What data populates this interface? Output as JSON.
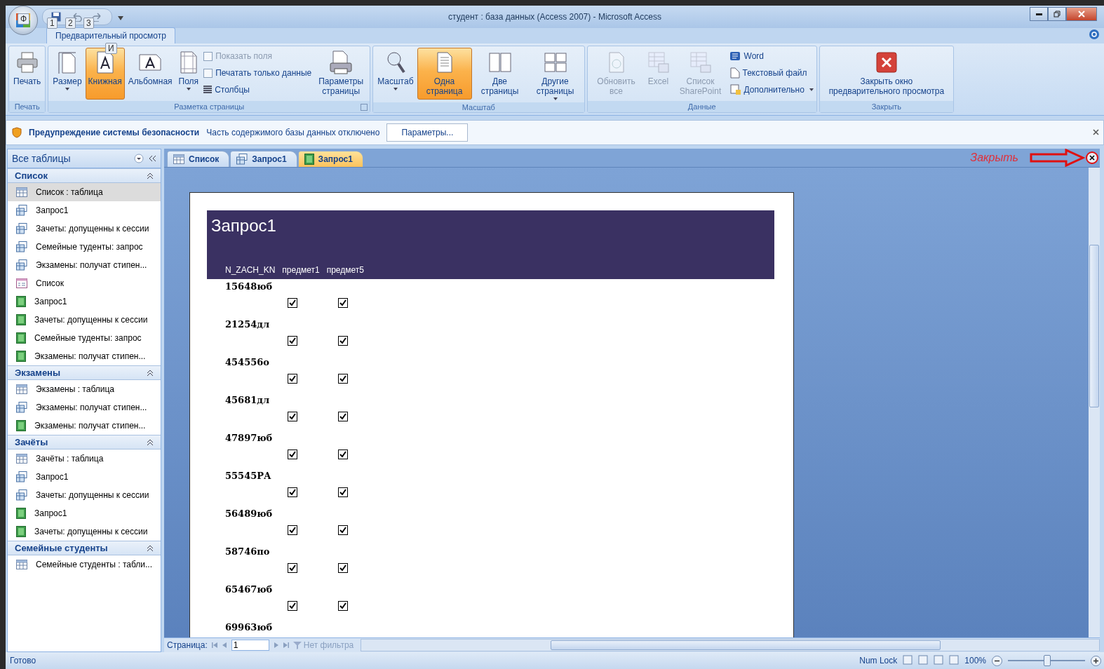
{
  "window": {
    "title": "студент : база данных (Access 2007) - Microsoft Access",
    "office_keytip": "Ф",
    "quick_keytips": [
      "1",
      "2",
      "3"
    ]
  },
  "ribbon": {
    "tab": {
      "label": "Предварительный просмотр",
      "keytip": "И",
      "selected": true
    },
    "groups": [
      {
        "label": "Печать",
        "launcher": false,
        "items": [
          {
            "kind": "large",
            "label": "Печать",
            "selected": false,
            "disabled": false,
            "dropdown": false
          }
        ]
      },
      {
        "label": "Разметка страницы",
        "launcher": true,
        "items": [
          {
            "kind": "large",
            "label": "Размер",
            "selected": false,
            "disabled": false,
            "dropdown": true
          },
          {
            "kind": "large",
            "label": "Книжная",
            "selected": true,
            "disabled": false,
            "dropdown": false
          },
          {
            "kind": "large",
            "label": "Альбомная",
            "selected": false,
            "disabled": false,
            "dropdown": false
          },
          {
            "kind": "large",
            "label": "Поля",
            "selected": false,
            "disabled": false,
            "dropdown": true
          },
          {
            "kind": "stack",
            "items": [
              {
                "kind": "check",
                "label": "Показать поля",
                "checked": false,
                "disabled": true
              },
              {
                "kind": "check",
                "label": "Печатать только данные",
                "checked": false,
                "disabled": false
              },
              {
                "kind": "small",
                "label": "Столбцы",
                "disabled": false,
                "dropdown": false
              }
            ]
          },
          {
            "kind": "large",
            "label": "Параметры страницы",
            "selected": false,
            "disabled": false,
            "dropdown": false
          }
        ]
      },
      {
        "label": "Масштаб",
        "launcher": false,
        "items": [
          {
            "kind": "large",
            "label": "Масштаб",
            "selected": false,
            "disabled": false,
            "dropdown": true
          },
          {
            "kind": "large",
            "label": "Одна страница",
            "selected": true,
            "disabled": false,
            "dropdown": false
          },
          {
            "kind": "large",
            "label": "Две страницы",
            "selected": false,
            "disabled": false,
            "dropdown": false
          },
          {
            "kind": "large",
            "label": "Другие страницы",
            "selected": false,
            "disabled": false,
            "dropdown": true
          }
        ]
      },
      {
        "label": "Данные",
        "launcher": false,
        "items": [
          {
            "kind": "large",
            "label": "Обновить все",
            "selected": false,
            "disabled": true,
            "dropdown": false
          },
          {
            "kind": "large",
            "label": "Excel",
            "selected": false,
            "disabled": true,
            "dropdown": false
          },
          {
            "kind": "large",
            "label": "Список SharePoint",
            "selected": false,
            "disabled": true,
            "dropdown": false
          },
          {
            "kind": "stack",
            "items": [
              {
                "kind": "small",
                "label": "Word",
                "disabled": false,
                "dropdown": false
              },
              {
                "kind": "small",
                "label": "Текстовый файл",
                "disabled": false,
                "dropdown": false
              },
              {
                "kind": "small",
                "label": "Дополнительно",
                "disabled": false,
                "dropdown": true
              }
            ]
          }
        ]
      },
      {
        "label": "Закрыть",
        "launcher": false,
        "items": [
          {
            "kind": "large",
            "label": "Закрыть окно предварительного просмотра",
            "selected": false,
            "disabled": false,
            "dropdown": false
          }
        ]
      }
    ]
  },
  "security_bar": {
    "title": "Предупреждение системы безопасности",
    "message": "Часть содержимого базы данных отключено",
    "button": "Параметры..."
  },
  "nav_pane": {
    "title": "Все таблицы",
    "groups": [
      {
        "label": "Список",
        "expanded": true,
        "items": [
          {
            "kind": "table",
            "label": "Список : таблица",
            "selected": true
          },
          {
            "kind": "query",
            "label": "Запрос1",
            "selected": false
          },
          {
            "kind": "query",
            "label": "Зачеты: допущенны к сессии",
            "selected": false
          },
          {
            "kind": "query",
            "label": "Семейные туденты: запрос",
            "selected": false
          },
          {
            "kind": "query",
            "label": "Экзамены: получат стипен...",
            "selected": false
          },
          {
            "kind": "form",
            "label": "Список",
            "selected": false
          },
          {
            "kind": "report",
            "label": "Запрос1",
            "selected": false
          },
          {
            "kind": "report",
            "label": "Зачеты: допущенны к сессии",
            "selected": false
          },
          {
            "kind": "report",
            "label": "Семейные туденты: запрос",
            "selected": false
          },
          {
            "kind": "report",
            "label": "Экзамены: получат стипен...",
            "selected": false
          }
        ]
      },
      {
        "label": "Экзамены",
        "expanded": true,
        "items": [
          {
            "kind": "table",
            "label": "Экзамены : таблица",
            "selected": false
          },
          {
            "kind": "query",
            "label": "Экзамены: получат стипен...",
            "selected": false
          },
          {
            "kind": "report",
            "label": "Экзамены: получат стипен...",
            "selected": false
          }
        ]
      },
      {
        "label": "Зачёты",
        "expanded": true,
        "items": [
          {
            "kind": "table",
            "label": "Зачёты : таблица",
            "selected": false
          },
          {
            "kind": "query",
            "label": "Запрос1",
            "selected": false
          },
          {
            "kind": "query",
            "label": "Зачеты: допущенны к сессии",
            "selected": false
          },
          {
            "kind": "report",
            "label": "Запрос1",
            "selected": false
          },
          {
            "kind": "report",
            "label": "Зачеты: допущенны к сессии",
            "selected": false
          }
        ]
      },
      {
        "label": "Семейные студенты",
        "expanded": true,
        "items": [
          {
            "kind": "table",
            "label": "Семейные студенты : табли...",
            "selected": false
          }
        ]
      }
    ]
  },
  "doc_tabs": [
    {
      "kind": "table",
      "label": "Список",
      "selected": false
    },
    {
      "kind": "query",
      "label": "Запрос1",
      "selected": false
    },
    {
      "kind": "report",
      "label": "Запрос1",
      "selected": true
    }
  ],
  "annotation": {
    "text": "Закрыть"
  },
  "report": {
    "title": "Запрос1",
    "columns": [
      "N_ZACH_KN",
      "предмет1",
      "предмет5"
    ],
    "rows": [
      {
        "id": "15648юб",
        "checks": [
          true,
          true
        ]
      },
      {
        "id": "21254дл",
        "checks": [
          true,
          true
        ]
      },
      {
        "id": "454556о",
        "checks": [
          true,
          true
        ]
      },
      {
        "id": "45681дл",
        "checks": [
          true,
          true
        ]
      },
      {
        "id": "47897юб",
        "checks": [
          true,
          true
        ]
      },
      {
        "id": "55545РА",
        "checks": [
          true,
          true
        ]
      },
      {
        "id": "56489юб",
        "checks": [
          true,
          true
        ]
      },
      {
        "id": "58746по",
        "checks": [
          true,
          true
        ]
      },
      {
        "id": "65467юб",
        "checks": [
          true,
          true
        ]
      },
      {
        "id": "69963юб"
      }
    ]
  },
  "record_nav": {
    "label": "Страница:",
    "value": "1",
    "filter": "Нет фильтра"
  },
  "status_bar": {
    "text": "Готово",
    "num_lock": "Num Lock",
    "zoom": "100%",
    "level": 0.5
  }
}
